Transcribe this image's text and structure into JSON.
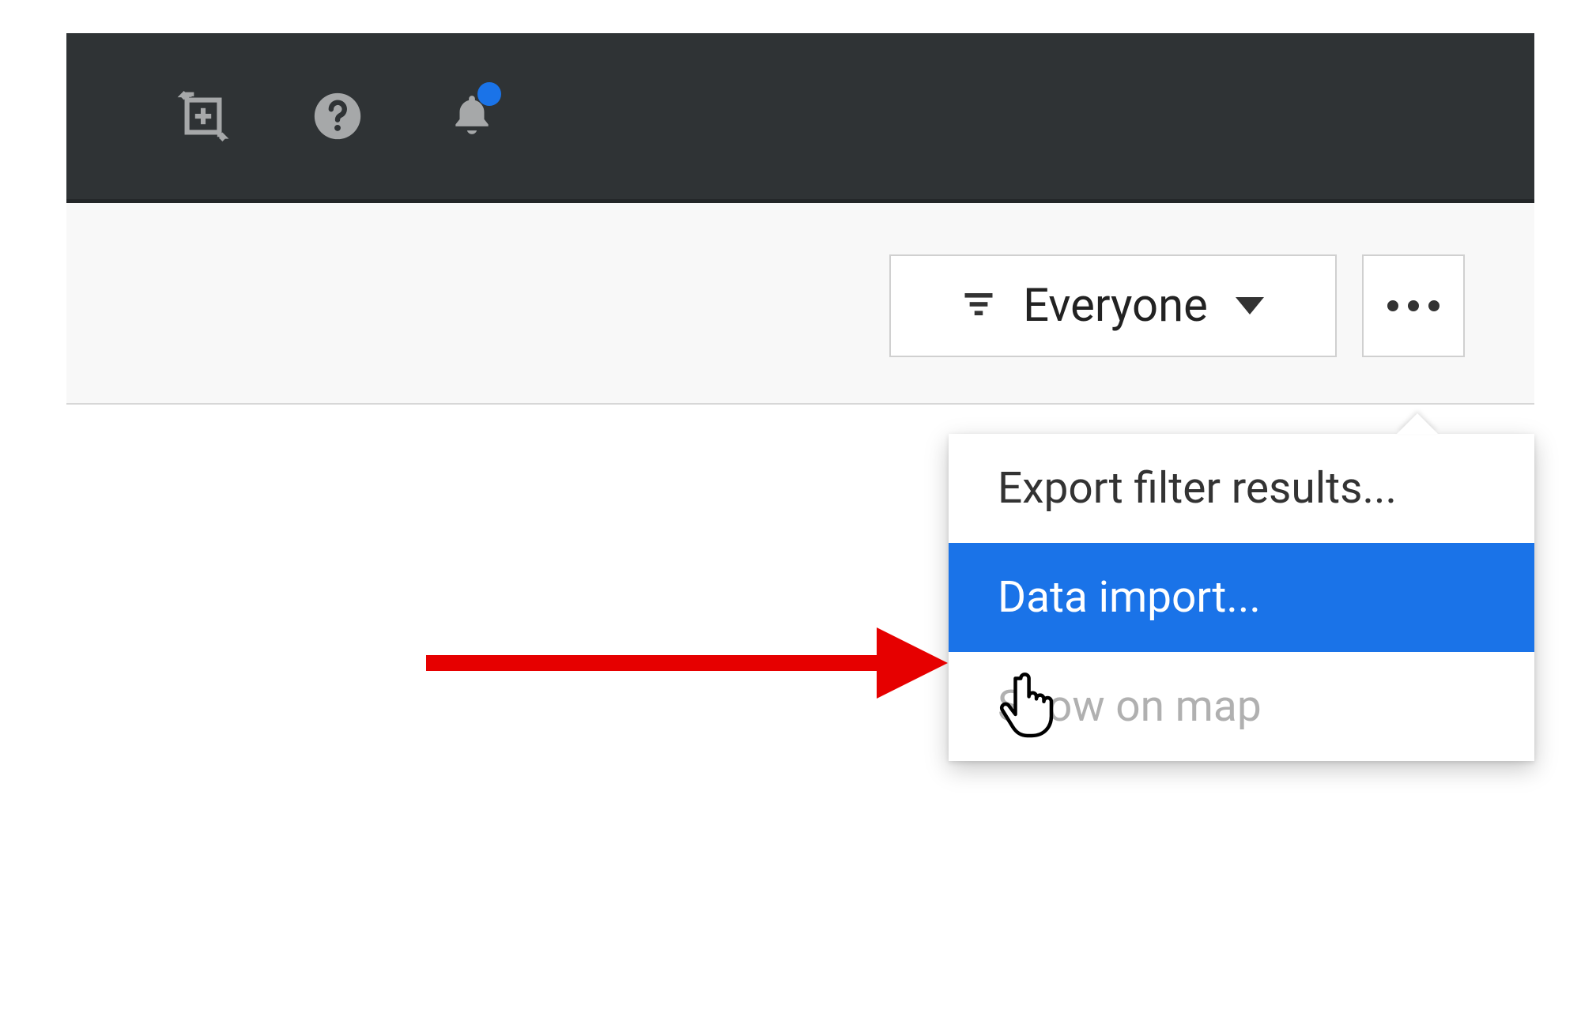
{
  "topbar": {
    "icons": {
      "add_swap": "add-swap-icon",
      "help": "help-icon",
      "bell": "bell-icon"
    }
  },
  "toolbar": {
    "filter_label": "Everyone",
    "more_label": "..."
  },
  "menu": {
    "items": [
      {
        "label": "Export filter results...",
        "state": "normal"
      },
      {
        "label": "Data import...",
        "state": "highlight"
      },
      {
        "label": "Show on map",
        "state": "disabled"
      }
    ]
  },
  "colors": {
    "accent": "#1a73e8",
    "annotation": "#e60000",
    "topbar_bg": "#2f3335"
  }
}
